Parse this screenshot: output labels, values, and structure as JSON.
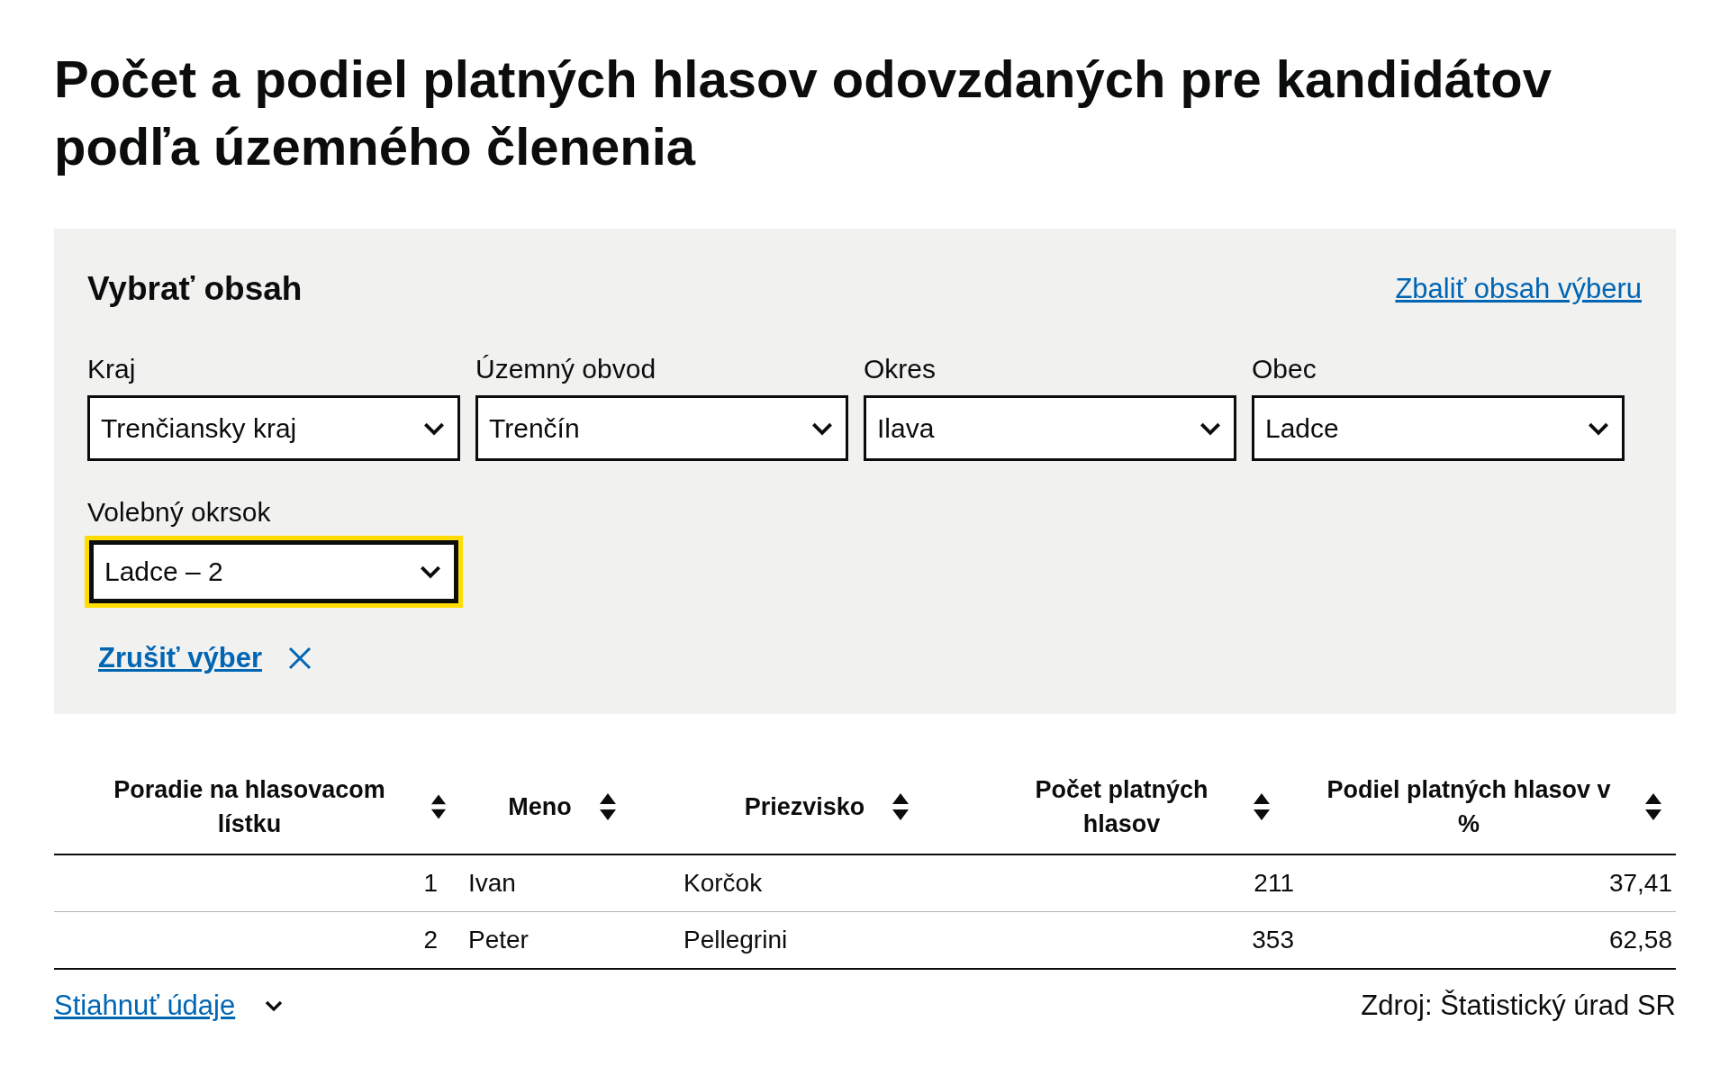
{
  "title": "Počet a podiel platných hlasov odovzdaných pre kandidátov podľa územného členenia",
  "filter_panel": {
    "heading": "Vybrať obsah",
    "collapse_link": "Zbaliť obsah výberu",
    "filters": [
      {
        "label": "Kraj",
        "value": "Trenčiansky kraj",
        "focused": false
      },
      {
        "label": "Územný obvod",
        "value": "Trenčín",
        "focused": false
      },
      {
        "label": "Okres",
        "value": "Ilava",
        "focused": false
      },
      {
        "label": "Obec",
        "value": "Ladce",
        "focused": false
      },
      {
        "label": "Volebný okrsok",
        "value": "Ladce – 2",
        "focused": true
      }
    ],
    "clear_link": "Zrušiť výber"
  },
  "table": {
    "columns": [
      {
        "label": "Poradie na hlasovacom lístku",
        "kind": "number"
      },
      {
        "label": "Meno",
        "kind": "text"
      },
      {
        "label": "Priezvisko",
        "kind": "text"
      },
      {
        "label": "Počet platných hlasov",
        "kind": "number"
      },
      {
        "label": "Podiel platných hlasov v %",
        "kind": "number"
      }
    ],
    "rows": [
      [
        "1",
        "Ivan",
        "Korčok",
        "211",
        "37,41"
      ],
      [
        "2",
        "Peter",
        "Pellegrini",
        "353",
        "62,58"
      ]
    ]
  },
  "footer": {
    "download_link": "Stiahnuť údaje",
    "source": "Zdroj: Štatistický úrad SR"
  }
}
